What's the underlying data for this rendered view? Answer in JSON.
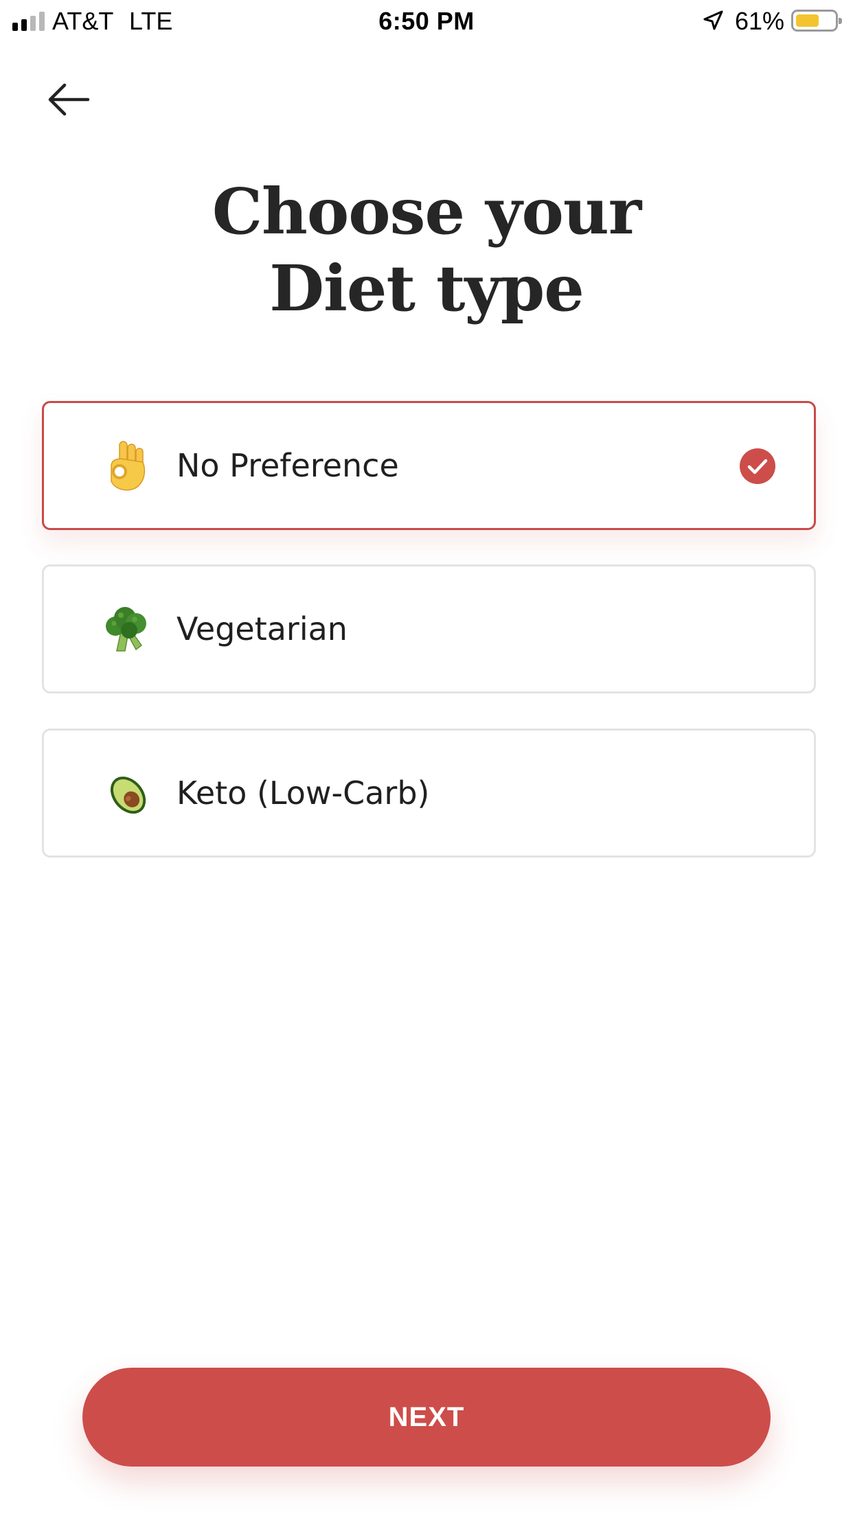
{
  "status_bar": {
    "carrier": "AT&T",
    "network": "LTE",
    "time": "6:50 PM",
    "battery_percent": "61%",
    "battery_level": 0.61,
    "signal_bars": 2,
    "icons": [
      "signal-icon",
      "location-arrow-icon",
      "battery-icon"
    ]
  },
  "header": {
    "back_icon": "arrow-left-icon",
    "title_line1": "Choose your",
    "title_line2": "Diet type"
  },
  "options": [
    {
      "label": "No Preference",
      "icon": "ok-hand-emoji",
      "selected": true
    },
    {
      "label": "Vegetarian",
      "icon": "broccoli-emoji",
      "selected": false
    },
    {
      "label": "Keto (Low-Carb)",
      "icon": "avocado-emoji",
      "selected": false
    }
  ],
  "next_button": {
    "label": "NEXT"
  },
  "colors": {
    "accent": "#cd4d4a",
    "selected_border": "#c94a48",
    "card_border": "#e3e3e3",
    "title": "#262626",
    "text": "#202020",
    "battery": "#f4c430"
  }
}
